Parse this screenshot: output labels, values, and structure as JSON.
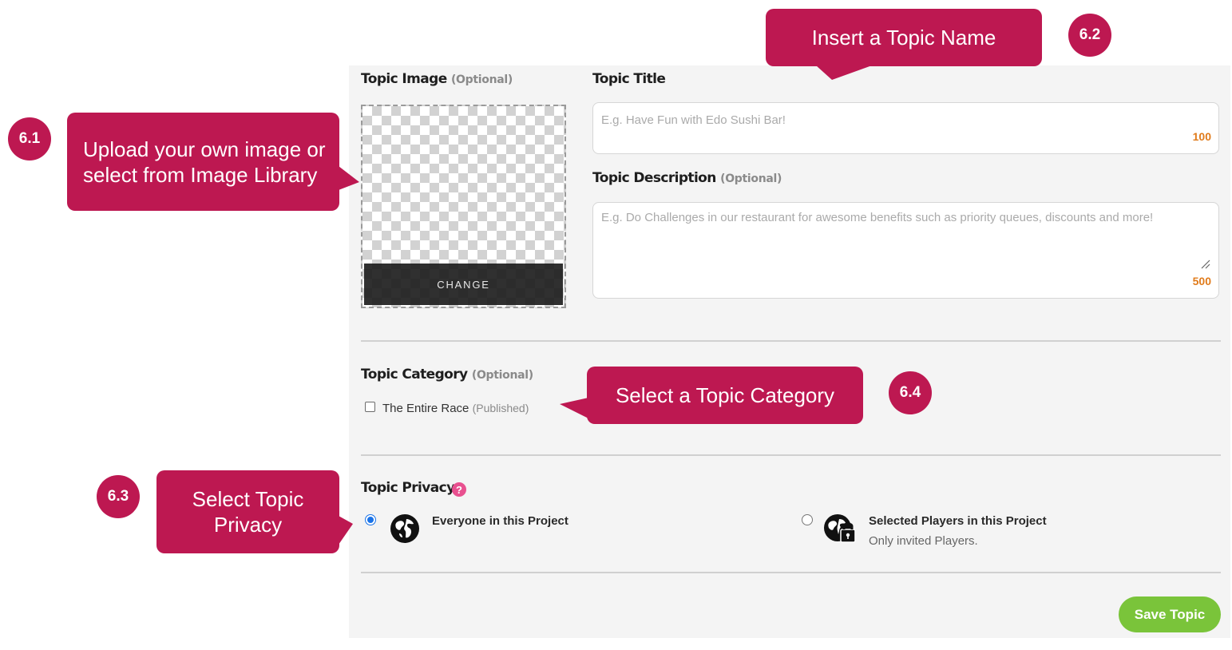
{
  "form": {
    "image_label": "Topic Image",
    "image_optional": "(Optional)",
    "change_label": "CHANGE",
    "title_label": "Topic Title",
    "title_placeholder": "E.g. Have Fun with Edo Sushi Bar!",
    "title_counter": "100",
    "desc_label": "Topic Description",
    "desc_optional": "(Optional)",
    "desc_placeholder": "E.g. Do Challenges in our restaurant for awesome benefits such as priority queues, discounts and more!",
    "desc_counter": "500",
    "category_label": "Topic Category",
    "category_optional": "(Optional)",
    "category_item": "The Entire Race",
    "category_item_status": "(Published)",
    "privacy_label": "Topic Privacy",
    "help_glyph": "?",
    "privacy_options": [
      {
        "title": "Everyone in this Project",
        "subtitle": "",
        "selected": true,
        "icon": "globe-icon"
      },
      {
        "title": "Selected Players in this Project",
        "subtitle": "Only invited Players.",
        "selected": false,
        "icon": "globe-lock-icon"
      }
    ],
    "save_label": "Save Topic"
  },
  "callouts": {
    "topic_name": "Insert a Topic Name",
    "upload_line1": "Upload your own image or",
    "upload_line2": "select from Image Library",
    "category": "Select a Topic Category",
    "privacy_line1": "Select Topic",
    "privacy_line2": "Privacy"
  },
  "badges": {
    "b61": "6.1",
    "b62": "6.2",
    "b63": "6.3",
    "b64": "6.4"
  },
  "colors": {
    "callout": "#bd1851",
    "save_button": "#7ac43a",
    "counter": "#e07b1b",
    "help": "#e8508f",
    "radio": "#1a73e8"
  }
}
